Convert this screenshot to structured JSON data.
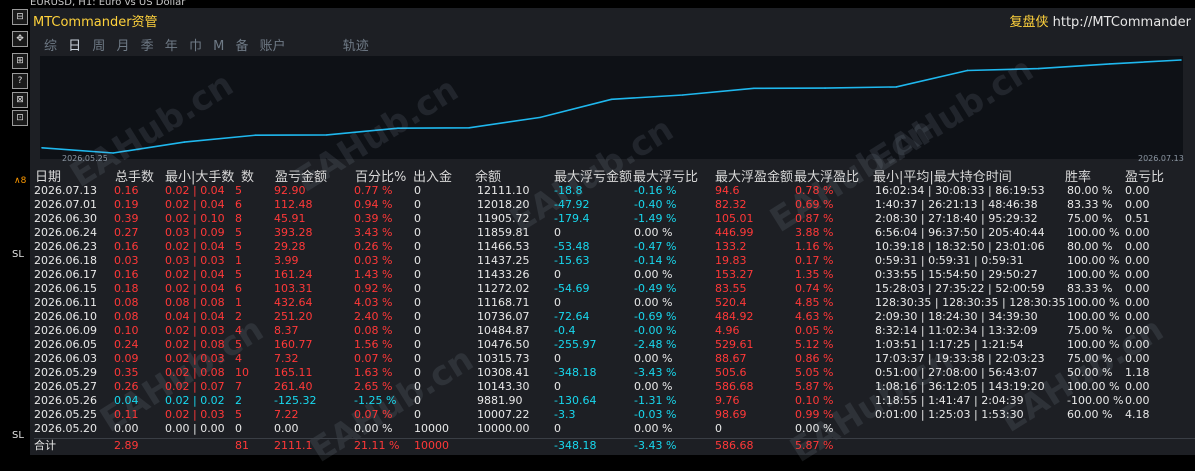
{
  "window": {
    "symbol_title": "EURUSD, H1: Euro vs US Dollar"
  },
  "left_toolbar": {
    "buttons": [
      "⊟",
      "✥",
      "⊞",
      "?",
      "⊠",
      "⊡"
    ],
    "sl_labels": [
      "SL",
      "SL"
    ],
    "tag": "∧8"
  },
  "panel": {
    "title": "MTCommander资管",
    "right_brand": "复盘侠",
    "right_url": "http://MTCommander",
    "tabs": [
      "综",
      "日",
      "周",
      "月",
      "季",
      "年",
      "巾",
      "M",
      "备",
      "账户"
    ],
    "active_tab": "日",
    "track_tab": "轨迹"
  },
  "chart_data": {
    "type": "line",
    "x": [
      "2026.05.25",
      "2026.05.26",
      "2026.05.27",
      "2026.05.29",
      "2026.06.03",
      "2026.06.05",
      "2026.06.09",
      "2026.06.10",
      "2026.06.11",
      "2026.06.15",
      "2026.06.17",
      "2026.06.18",
      "2026.06.23",
      "2026.06.24",
      "2026.06.30",
      "2026.07.01",
      "2026.07.13"
    ],
    "values": [
      10007.22,
      9881.9,
      10143.3,
      10308.41,
      10315.73,
      10476.5,
      10484.87,
      10736.07,
      11168.71,
      11272.02,
      11433.26,
      11437.25,
      11466.53,
      11859.81,
      11905.72,
      12018.2,
      12111.1
    ],
    "x_start_label": "2026.05.25",
    "x_end_label": "2026.07.13",
    "color": "#1fb8ee",
    "grid": false
  },
  "table": {
    "headers": [
      "日期",
      "总手数",
      "最小|大手数",
      "数",
      "盈亏金额",
      "百分比%",
      "出入金",
      "余额",
      "最大浮亏金额",
      "最大浮亏比",
      "最大浮盈金额",
      "最大浮盈比",
      "最小|平均|最大持仓时间",
      "胜率",
      "盈亏比"
    ],
    "rows": [
      {
        "date": "2026.07.13",
        "lots": "0.16",
        "minmax": "0.02 | 0.04",
        "n": "5",
        "pnl": "92.90",
        "pct": "0.77 %",
        "io": "0",
        "bal": "12111.10",
        "mfl": "-18.8",
        "mflp": "-0.16 %",
        "mfg": "94.6",
        "mfgp": "0.78 %",
        "hold": "16:02:34 | 30:08:33 | 86:19:53",
        "win": "80.00 %",
        "pf": "0.00"
      },
      {
        "date": "2026.07.01",
        "lots": "0.19",
        "minmax": "0.02 | 0.04",
        "n": "6",
        "pnl": "112.48",
        "pct": "0.94 %",
        "io": "0",
        "bal": "12018.20",
        "mfl": "-47.92",
        "mflp": "-0.40 %",
        "mfg": "82.32",
        "mfgp": "0.69 %",
        "hold": "1:40:37 | 26:21:13 | 48:46:38",
        "win": "83.33 %",
        "pf": "0.00"
      },
      {
        "date": "2026.06.30",
        "lots": "0.39",
        "minmax": "0.02 | 0.10",
        "n": "8",
        "pnl": "45.91",
        "pct": "0.39 %",
        "io": "0",
        "bal": "11905.72",
        "mfl": "-179.4",
        "mflp": "-1.49 %",
        "mfg": "105.01",
        "mfgp": "0.87 %",
        "hold": "2:08:30 | 27:18:40 | 95:29:32",
        "win": "75.00 %",
        "pf": "0.51"
      },
      {
        "date": "2026.06.24",
        "lots": "0.27",
        "minmax": "0.03 | 0.09",
        "n": "5",
        "pnl": "393.28",
        "pct": "3.43 %",
        "io": "0",
        "bal": "11859.81",
        "mfl": "0",
        "mflp": "0.00 %",
        "mfg": "446.99",
        "mfgp": "3.88 %",
        "hold": "6:56:04 | 96:37:50 | 205:40:44",
        "win": "100.00 %",
        "pf": "0.00"
      },
      {
        "date": "2026.06.23",
        "lots": "0.16",
        "minmax": "0.02 | 0.04",
        "n": "5",
        "pnl": "29.28",
        "pct": "0.26 %",
        "io": "0",
        "bal": "11466.53",
        "mfl": "-53.48",
        "mflp": "-0.47 %",
        "mfg": "133.2",
        "mfgp": "1.16 %",
        "hold": "10:39:18 | 18:32:50 | 23:01:06",
        "win": "80.00 %",
        "pf": "0.00"
      },
      {
        "date": "2026.06.18",
        "lots": "0.03",
        "minmax": "0.03 | 0.03",
        "n": "1",
        "pnl": "3.99",
        "pct": "0.03 %",
        "io": "0",
        "bal": "11437.25",
        "mfl": "-15.63",
        "mflp": "-0.14 %",
        "mfg": "19.83",
        "mfgp": "0.17 %",
        "hold": "0:59:31 | 0:59:31 | 0:59:31",
        "win": "100.00 %",
        "pf": "0.00"
      },
      {
        "date": "2026.06.17",
        "lots": "0.16",
        "minmax": "0.02 | 0.04",
        "n": "5",
        "pnl": "161.24",
        "pct": "1.43 %",
        "io": "0",
        "bal": "11433.26",
        "mfl": "0",
        "mflp": "0.00 %",
        "mfg": "153.27",
        "mfgp": "1.35 %",
        "hold": "0:33:55 | 15:54:50 | 29:50:27",
        "win": "100.00 %",
        "pf": "0.00"
      },
      {
        "date": "2026.06.15",
        "lots": "0.18",
        "minmax": "0.02 | 0.04",
        "n": "6",
        "pnl": "103.31",
        "pct": "0.92 %",
        "io": "0",
        "bal": "11272.02",
        "mfl": "-54.69",
        "mflp": "-0.49 %",
        "mfg": "83.55",
        "mfgp": "0.74 %",
        "hold": "15:28:03 | 27:35:22 | 52:00:59",
        "win": "83.33 %",
        "pf": "0.00"
      },
      {
        "date": "2026.06.11",
        "lots": "0.08",
        "minmax": "0.08 | 0.08",
        "n": "1",
        "pnl": "432.64",
        "pct": "4.03 %",
        "io": "0",
        "bal": "11168.71",
        "mfl": "0",
        "mflp": "0.00 %",
        "mfg": "520.4",
        "mfgp": "4.85 %",
        "hold": "128:30:35 | 128:30:35 | 128:30:35",
        "win": "100.00 %",
        "pf": "0.00"
      },
      {
        "date": "2026.06.10",
        "lots": "0.08",
        "minmax": "0.04 | 0.04",
        "n": "2",
        "pnl": "251.20",
        "pct": "2.40 %",
        "io": "0",
        "bal": "10736.07",
        "mfl": "-72.64",
        "mflp": "-0.69 %",
        "mfg": "484.92",
        "mfgp": "4.63 %",
        "hold": "2:09:30 | 18:24:30 | 34:39:30",
        "win": "100.00 %",
        "pf": "0.00"
      },
      {
        "date": "2026.06.09",
        "lots": "0.10",
        "minmax": "0.02 | 0.03",
        "n": "4",
        "pnl": "8.37",
        "pct": "0.08 %",
        "io": "0",
        "bal": "10484.87",
        "mfl": "-0.4",
        "mflp": "-0.00 %",
        "mfg": "4.96",
        "mfgp": "0.05 %",
        "hold": "8:32:14 | 11:02:34 | 13:32:09",
        "win": "75.00 %",
        "pf": "0.00"
      },
      {
        "date": "2026.06.05",
        "lots": "0.24",
        "minmax": "0.02 | 0.08",
        "n": "5",
        "pnl": "160.77",
        "pct": "1.56 %",
        "io": "0",
        "bal": "10476.50",
        "mfl": "-255.97",
        "mflp": "-2.48 %",
        "mfg": "529.61",
        "mfgp": "5.12 %",
        "hold": "1:03:51 | 1:17:25 | 1:21:54",
        "win": "100.00 %",
        "pf": "0.00"
      },
      {
        "date": "2026.06.03",
        "lots": "0.09",
        "minmax": "0.02 | 0.03",
        "n": "4",
        "pnl": "7.32",
        "pct": "0.07 %",
        "io": "0",
        "bal": "10315.73",
        "mfl": "0",
        "mflp": "0.00 %",
        "mfg": "88.67",
        "mfgp": "0.86 %",
        "hold": "17:03:37 | 19:33:38 | 22:03:23",
        "win": "75.00 %",
        "pf": "0.00"
      },
      {
        "date": "2026.05.29",
        "lots": "0.35",
        "minmax": "0.02 | 0.08",
        "n": "10",
        "pnl": "165.11",
        "pct": "1.63 %",
        "io": "0",
        "bal": "10308.41",
        "mfl": "-348.18",
        "mflp": "-3.43 %",
        "mfg": "505.6",
        "mfgp": "5.05 %",
        "hold": "0:51:00 | 27:08:00 | 56:43:07",
        "win": "50.00 %",
        "pf": "1.18"
      },
      {
        "date": "2026.05.27",
        "lots": "0.26",
        "minmax": "0.02 | 0.07",
        "n": "7",
        "pnl": "261.40",
        "pct": "2.65 %",
        "io": "0",
        "bal": "10143.30",
        "mfl": "0",
        "mflp": "0.00 %",
        "mfg": "586.68",
        "mfgp": "5.87 %",
        "hold": "1:08:16 | 36:12:05 | 143:19:20",
        "win": "100.00 %",
        "pf": "0.00"
      },
      {
        "date": "2026.05.26",
        "lots": "0.04",
        "minmax": "0.02 | 0.02",
        "n": "2",
        "pnl": "-125.32",
        "pct": "-1.25 %",
        "io": "0",
        "bal": "9881.90",
        "mfl": "-130.64",
        "mflp": "-1.31 %",
        "mfg": "9.76",
        "mfgp": "0.10 %",
        "hold": "1:18:55 | 1:41:47 | 2:04:39",
        "win": "-100.00 %",
        "pf": "0.00"
      },
      {
        "date": "2026.05.25",
        "lots": "0.11",
        "minmax": "0.02 | 0.03",
        "n": "5",
        "pnl": "7.22",
        "pct": "0.07 %",
        "io": "0",
        "bal": "10007.22",
        "mfl": "-3.3",
        "mflp": "-0.03 %",
        "mfg": "98.69",
        "mfgp": "0.99 %",
        "hold": "0:01:00 | 1:25:03 | 1:53:30",
        "win": "60.00 %",
        "pf": "4.18"
      },
      {
        "date": "2026.05.20",
        "lots": "0.00",
        "minmax": "0.00 | 0.00",
        "n": "0",
        "pnl": "0.00",
        "pct": "0.00 %",
        "io": "10000",
        "bal": "10000.00",
        "mfl": "0",
        "mflp": "0.00 %",
        "mfg": "0",
        "mfgp": "0.00 %",
        "hold": "",
        "win": "",
        "pf": ""
      }
    ],
    "total": {
      "label": "合计",
      "lots": "2.89",
      "n": "81",
      "pnl": "2111.1",
      "pct": "21.11 %",
      "io": "10000",
      "mfl": "-348.18",
      "mflp": "-3.43 %",
      "mfg": "586.68",
      "mfgp": "5.87 %"
    }
  },
  "watermark": "EAHub.cn"
}
